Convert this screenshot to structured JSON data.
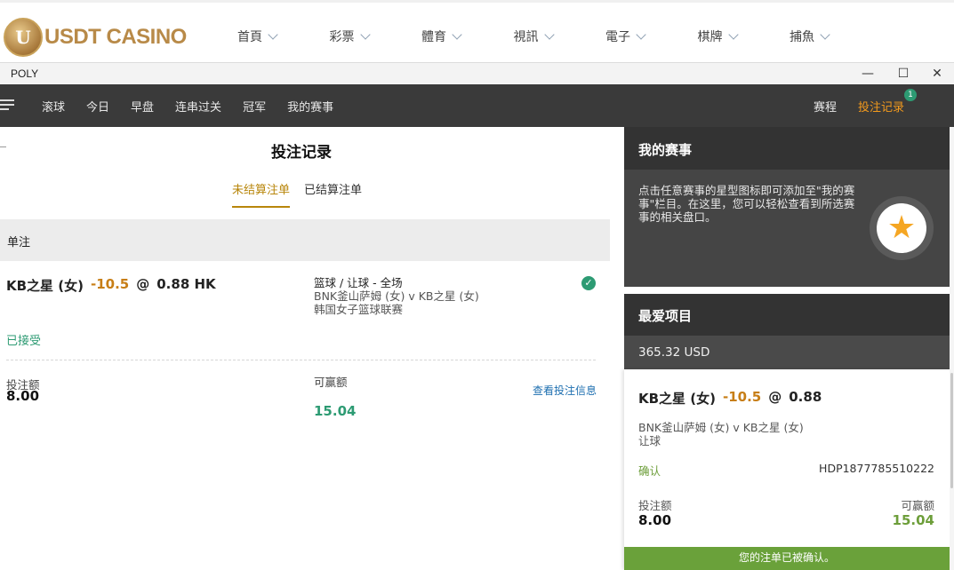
{
  "site": {
    "logo_text": "USDT CASINO",
    "nav": [
      "首頁",
      "彩票",
      "體育",
      "視訊",
      "電子",
      "棋牌",
      "捕魚"
    ]
  },
  "window": {
    "title": "POLY",
    "minimize": "—",
    "maximize": "☐",
    "close": "✕"
  },
  "app_nav": {
    "tabs": [
      "滚球",
      "今日",
      "早盘",
      "连串过关",
      "冠军",
      "我的赛事"
    ],
    "schedule": "赛程",
    "bet_record": "投注记录",
    "bet_record_badge": "1"
  },
  "bet_records": {
    "title": "投注记录",
    "tab_unsettled": "未结算注单",
    "tab_settled": "已结算注单",
    "section": "单注",
    "bet": {
      "team": "KB之星 (女)",
      "handicap": "-10.5",
      "at": "@",
      "odds": "0.88 HK",
      "market": "篮球 / 让球 - 全场",
      "match": "BNK釜山萨姆 (女) v KB之星 (女)",
      "league": "韩国女子篮球联赛",
      "status": "已接受",
      "stake_label": "投注额",
      "stake": "8.00",
      "win_label": "可赢额",
      "win": "15.04",
      "view_link": "查看投注信息"
    }
  },
  "my_events": {
    "title": "我的赛事",
    "text": "点击任意赛事的星型图标即可添加至\"我的赛事\"栏目。在这里，您可以轻松查看到所选赛事的相关盘口。"
  },
  "favorites": {
    "title": "最爱项目",
    "balance": "365.32 USD"
  },
  "slip": {
    "team": "KB之星 (女)",
    "handicap": "-10.5",
    "at": "@",
    "odds": "0.88",
    "match": "BNK釜山萨姆 (女) v KB之星 (女)",
    "market": "让球",
    "confirm_label": "确认",
    "ticket_id": "HDP1877785510222",
    "stake_label": "投注额",
    "stake": "8.00",
    "win_label": "可赢额",
    "win": "15.04",
    "banner": "您的注单已被确认。"
  },
  "colors": {
    "accent_orange": "#f39a1d",
    "handicap": "#c77e16",
    "green": "#2d9b73",
    "confirm_green": "#6aa13a",
    "dark_nav": "#3a3a3a"
  }
}
